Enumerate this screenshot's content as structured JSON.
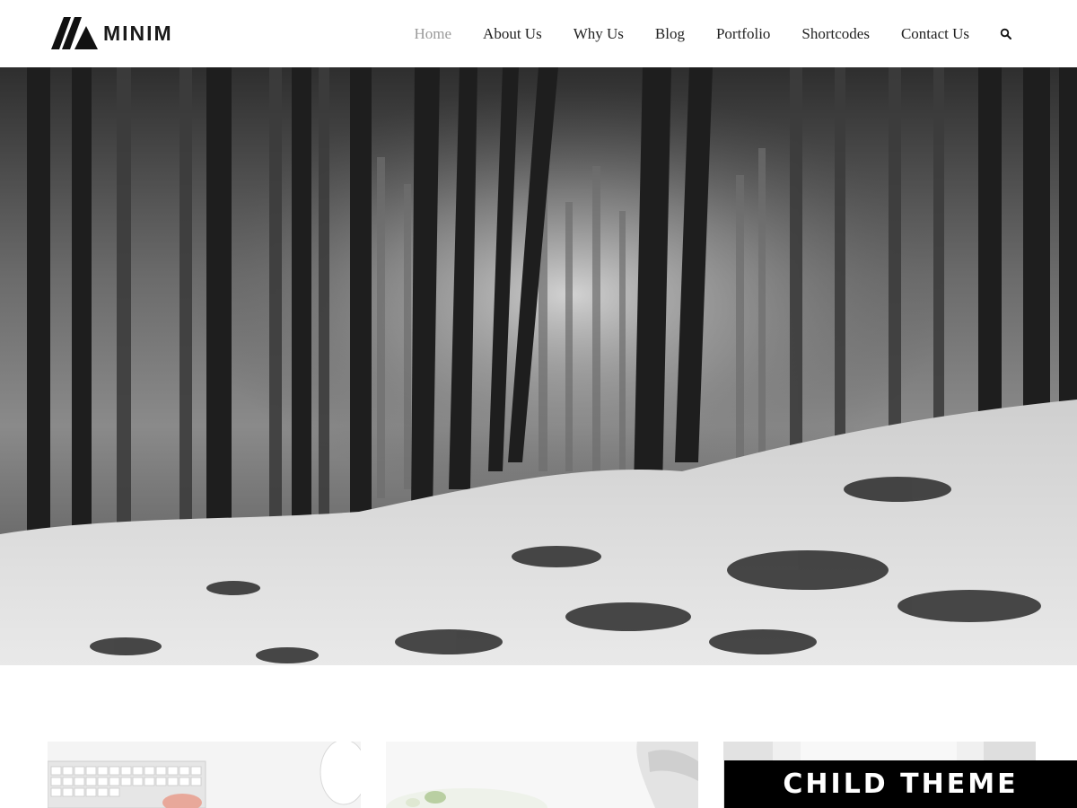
{
  "brand": {
    "name": "MINIM",
    "icon": "mountain-logo-icon"
  },
  "nav": {
    "items": [
      {
        "label": "Home",
        "active": true
      },
      {
        "label": "About Us",
        "active": false
      },
      {
        "label": "Why Us",
        "active": false
      },
      {
        "label": "Blog",
        "active": false
      },
      {
        "label": "Portfolio",
        "active": false
      },
      {
        "label": "Shortcodes",
        "active": false
      },
      {
        "label": "Contact Us",
        "active": false
      }
    ],
    "search_icon": "search-icon"
  },
  "hero": {
    "image": "black-and-white snowy forest"
  },
  "cards": [
    {
      "image": "keyboard and mouse on desk"
    },
    {
      "image": "plant and person at desk"
    },
    {
      "image": "white interior"
    }
  ],
  "badge": {
    "label": "CHILD THEME"
  },
  "colors": {
    "nav_active": "#9a9a9a",
    "nav_text": "#222222",
    "badge_bg": "#000000"
  }
}
